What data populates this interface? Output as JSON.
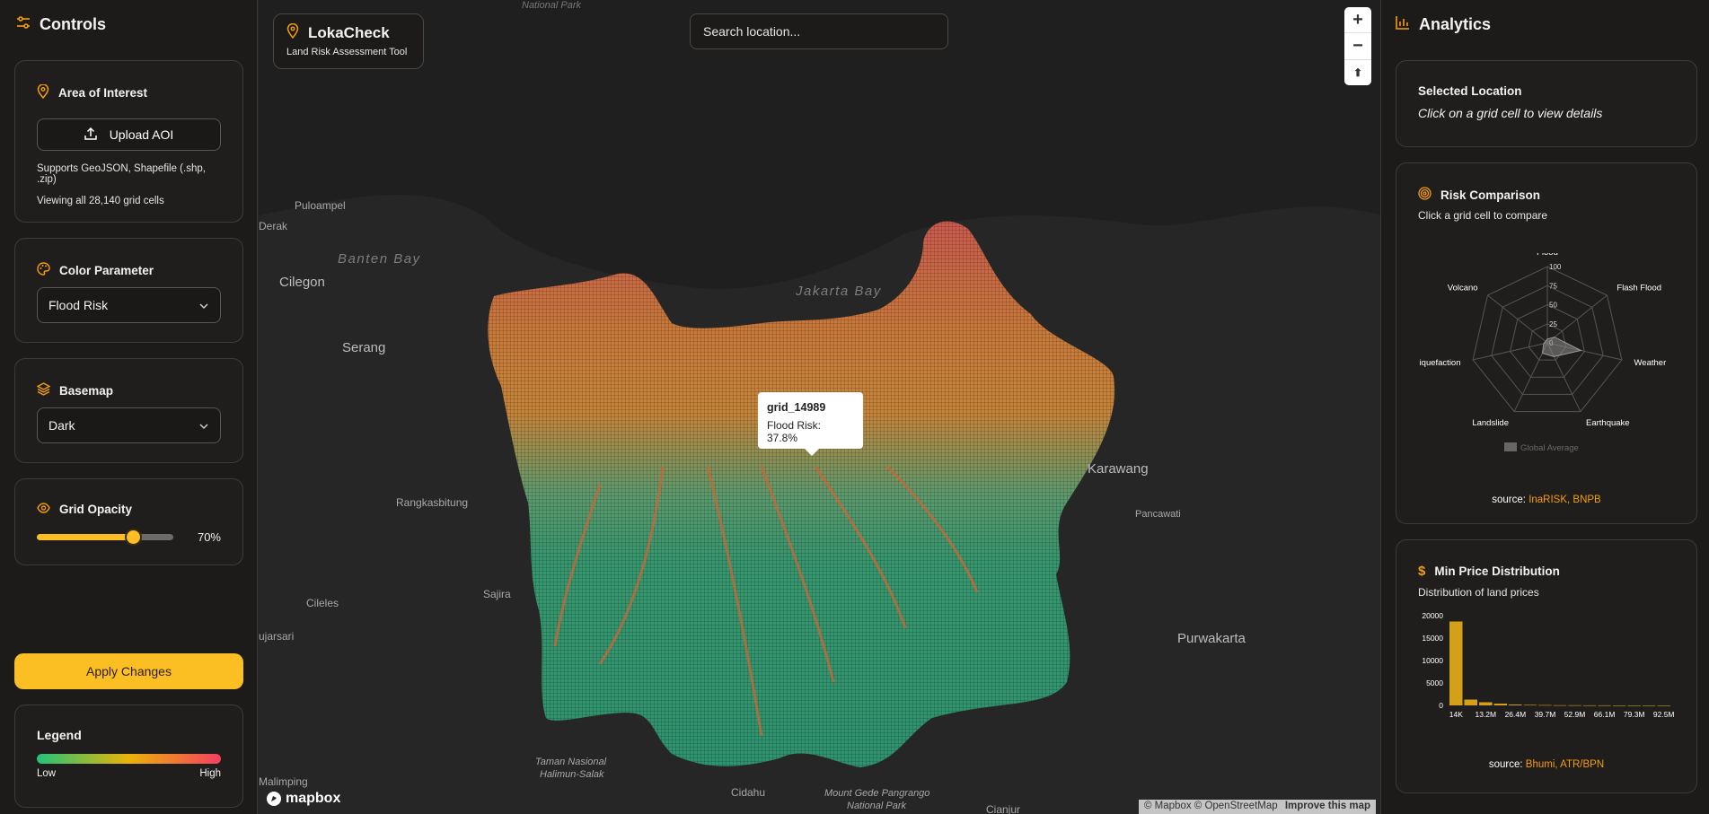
{
  "left": {
    "title": "Controls",
    "aoi": {
      "title": "Area of Interest",
      "upload_label": "Upload AOI",
      "supports": "Supports GeoJSON, Shapefile (.shp, .zip)",
      "viewing": "Viewing all 28,140 grid cells"
    },
    "color_param": {
      "title": "Color Parameter",
      "value": "Flood Risk"
    },
    "basemap": {
      "title": "Basemap",
      "value": "Dark"
    },
    "opacity": {
      "title": "Grid Opacity",
      "value": 0.7,
      "value_label": "70%"
    },
    "apply_label": "Apply Changes",
    "legend": {
      "title": "Legend",
      "low": "Low",
      "high": "High"
    }
  },
  "map": {
    "brand_title": "LokaCheck",
    "brand_sub": "Land Risk Assessment Tool",
    "search_placeholder": "Search location...",
    "zoom_in": "+",
    "zoom_out": "−",
    "compass": "⬆",
    "places": {
      "pulo": "Puloampel",
      "derak": "Derak",
      "cilegon": "Cilegon",
      "serang": "Serang",
      "rangkas": "Rangkasbitung",
      "ciledes": "Cileles",
      "sajira": "Sajira",
      "jarsari": "ujarsari",
      "malimping": "Malimping",
      "karawang": "Karawang",
      "pancawati": "Pancawati",
      "purwakarta": "Purwakarta",
      "cidahu": "Cidahu",
      "cianjur": "Cianjur",
      "park_top": "National Park",
      "halimun1": "Taman Nasional",
      "halimun2": "Halimun-Salak",
      "gede1": "Mount Gede Pangrango",
      "gede2": "National Park"
    },
    "water": {
      "banten": "Banten Bay",
      "jakarta": "Jakarta Bay"
    },
    "tooltip": {
      "title": "grid_14989",
      "value": "Flood Risk: 37.8%"
    },
    "mapbox": "mapbox",
    "attribution": "© Mapbox © OpenStreetMap",
    "improve": "Improve this map"
  },
  "right": {
    "title": "Analytics",
    "selected": {
      "title": "Selected Location",
      "hint": "Click on a grid cell to view details"
    },
    "risk": {
      "title": "Risk Comparison",
      "sub": "Click a grid cell to compare",
      "legend": "Global Average",
      "source_prefix": "source: ",
      "source": "InaRISK, BNPB"
    },
    "price": {
      "title": "Min Price Distribution",
      "sub": "Distribution of land prices",
      "source_prefix": "source: ",
      "source": "Bhumi, ATR/BPN"
    }
  },
  "chart_data": [
    {
      "type": "radar",
      "axes": [
        "Flood",
        "Flash Flood",
        "Weather",
        "Earthquake",
        "Landslide",
        "iquefaction",
        "Volcano"
      ],
      "rlim": [
        0,
        100
      ],
      "ticks": [
        "100",
        "75",
        "50",
        "25",
        "0"
      ],
      "series": [
        {
          "name": "Global Average",
          "values": [
            5,
            12,
            45,
            20,
            15,
            5,
            3
          ]
        }
      ]
    },
    {
      "type": "bar",
      "categories": [
        "14K",
        "",
        "13.2M",
        "",
        "26.4M",
        "",
        "39.7M",
        "",
        "52.9M",
        "",
        "66.1M",
        "",
        "79.3M",
        "",
        "92.5M"
      ],
      "tick_labels": [
        "14K",
        "13.2M",
        "26.4M",
        "39.7M",
        "52.9M",
        "66.1M",
        "79.3M",
        "92.5M"
      ],
      "values": [
        18700,
        1300,
        700,
        400,
        200,
        120,
        80,
        50,
        30,
        20,
        15,
        10,
        8,
        5,
        3
      ],
      "yticks": [
        "20000",
        "15000",
        "10000",
        "5000",
        "0"
      ],
      "ylim": [
        0,
        20000
      ]
    }
  ]
}
